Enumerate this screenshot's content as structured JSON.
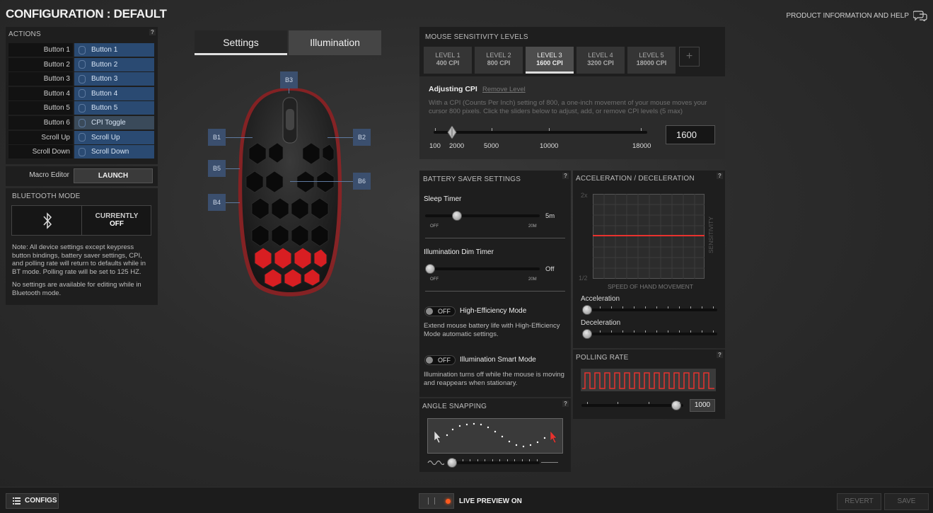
{
  "title": "CONFIGURATION : DEFAULT",
  "help_link": "PRODUCT INFORMATION AND HELP",
  "actions": {
    "header": "ACTIONS",
    "help": "?",
    "rows": [
      {
        "name": "Button 1",
        "binding": "Button 1"
      },
      {
        "name": "Button 2",
        "binding": "Button 2"
      },
      {
        "name": "Button 3",
        "binding": "Button 3"
      },
      {
        "name": "Button 4",
        "binding": "Button 4"
      },
      {
        "name": "Button 5",
        "binding": "Button 5"
      },
      {
        "name": "Button 6",
        "binding": "CPI Toggle"
      },
      {
        "name": "Scroll Up",
        "binding": "Scroll Up"
      },
      {
        "name": "Scroll Down",
        "binding": "Scroll Down"
      }
    ]
  },
  "macro": {
    "label": "Macro Editor",
    "button": "LAUNCH"
  },
  "bluetooth": {
    "header": "BLUETOOTH MODE",
    "status_label": "CURRENTLY",
    "status_value": "OFF",
    "note1": "Note: All device settings except keypress button bindings, battery saver settings, CPI, and polling rate will return to defaults while in BT mode. Polling rate will be set to 125 HZ.",
    "note2": "No settings are available for editing while in Bluetooth mode."
  },
  "tabs": {
    "settings": "Settings",
    "illumination": "Illumination"
  },
  "mouse_tags": {
    "b1": "B1",
    "b2": "B2",
    "b3": "B3",
    "b4": "B4",
    "b5": "B5",
    "b6": "B6"
  },
  "sensitivity": {
    "header": "MOUSE SENSITIVITY LEVELS",
    "levels": [
      {
        "name": "LEVEL 1",
        "cpi": "400 CPI"
      },
      {
        "name": "LEVEL 2",
        "cpi": "800 CPI"
      },
      {
        "name": "LEVEL 3",
        "cpi": "1600 CPI"
      },
      {
        "name": "LEVEL 4",
        "cpi": "3200 CPI"
      },
      {
        "name": "LEVEL 5",
        "cpi": "18000 CPI"
      }
    ],
    "active_level": 3,
    "add_label": "+",
    "adjusting_label": "Adjusting CPI",
    "remove_label": "Remove Level",
    "description": "With a CPI (Counts Per Inch) setting of 800, a one-inch movement of your mouse moves your cursor 800 pixels. Click the sliders below to adjust, add, or remove CPI levels (5 max)",
    "scale": [
      "100",
      "2000",
      "5000",
      "10000",
      "18000"
    ],
    "value": "1600"
  },
  "battery": {
    "header": "BATTERY SAVER SETTINGS",
    "help": "?",
    "sleep_label": "Sleep Timer",
    "sleep_value": "5m",
    "dim_label": "Illumination Dim Timer",
    "dim_value": "Off",
    "scale_min": "OFF",
    "scale_max": "20M",
    "he_toggle": "OFF",
    "he_label": "High-Efficiency Mode",
    "he_desc": "Extend mouse battery life with High-Efficiency Mode automatic settings.",
    "ism_toggle": "OFF",
    "ism_label": "Illumination Smart Mode",
    "ism_desc": "Illumination turns off while the mouse is moving and reappears when stationary."
  },
  "angle": {
    "header": "ANGLE SNAPPING",
    "help": "?"
  },
  "accel": {
    "header": "ACCELERATION / DECELERATION",
    "help": "?",
    "y_top": "2x",
    "y_bottom": "1/2",
    "y_label": "SENSITIVITY",
    "x_label": "SPEED OF HAND MOVEMENT",
    "acceleration": "Acceleration",
    "deceleration": "Deceleration"
  },
  "polling": {
    "header": "POLLING RATE",
    "help": "?",
    "value": "1000"
  },
  "bottom": {
    "configs": "CONFIGS",
    "live_preview": "LIVE PREVIEW ON",
    "revert": "REVERT",
    "save": "SAVE"
  },
  "colors": {
    "accent_red": "#e8322e",
    "binding_blue": "#2a4a72",
    "tag_blue": "#3b4f6e"
  }
}
